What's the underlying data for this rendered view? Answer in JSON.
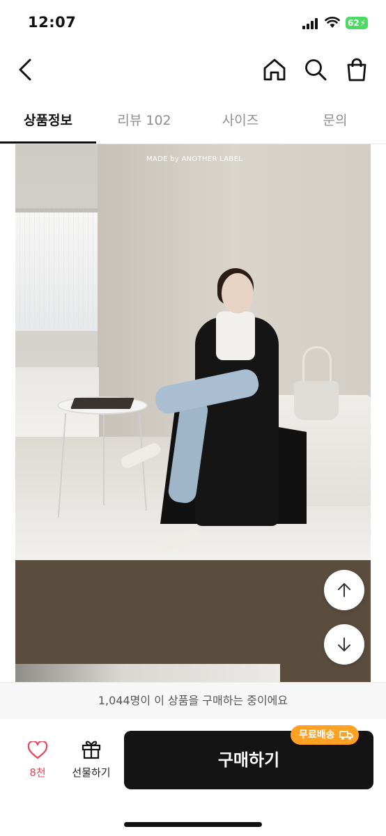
{
  "status_bar": {
    "time": "12:07",
    "battery": "62"
  },
  "header": {
    "back_icon": "chevron-left-icon",
    "home_icon": "home-icon",
    "search_icon": "search-icon",
    "cart_icon": "shopping-bag-icon"
  },
  "tabs": [
    {
      "label": "상품정보",
      "active": true
    },
    {
      "label": "리뷰 102",
      "active": false
    },
    {
      "label": "사이즈",
      "active": false
    },
    {
      "label": "문의",
      "active": false
    }
  ],
  "product_image": {
    "watermark": "MADE by ANOTHER LABEL"
  },
  "scroll": {
    "up_icon": "arrow-up-icon",
    "down_icon": "arrow-down-icon"
  },
  "buyers_notice": "1,044명이 이 상품을 구매하는 중이에요",
  "bottom_bar": {
    "like_count": "8천",
    "gift_label": "선물하기",
    "buy_label": "구매하기",
    "free_shipping_badge": "무료배송"
  },
  "colors": {
    "accent_like": "#e8455c",
    "badge": "#ffa224",
    "buy_button": "#141414"
  }
}
